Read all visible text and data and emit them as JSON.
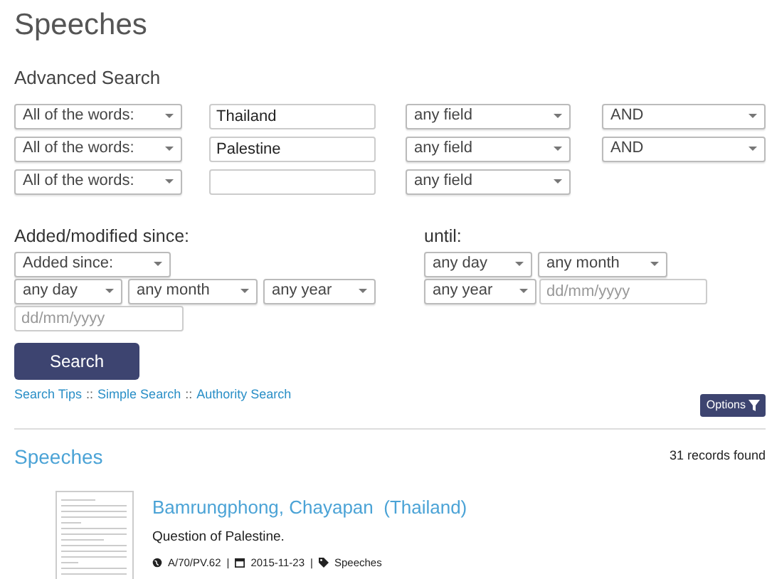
{
  "title": "Speeches",
  "advanced_search": {
    "heading": "Advanced Search",
    "rows": [
      {
        "match": "All of the words:",
        "term": "Thailand",
        "field": "any field",
        "operator": "AND"
      },
      {
        "match": "All of the words:",
        "term": "Palestine",
        "field": "any field",
        "operator": "AND"
      },
      {
        "match": "All of the words:",
        "term": "",
        "field": "any field"
      }
    ]
  },
  "since": {
    "heading": "Added/modified since:",
    "mode": "Added since:",
    "day": "any day",
    "month": "any month",
    "year": "any year",
    "date_placeholder": "dd/mm/yyyy"
  },
  "until": {
    "heading": "until:",
    "day": "any day",
    "month": "any month",
    "year": "any year",
    "date_placeholder": "dd/mm/yyyy"
  },
  "search_button": "Search",
  "links": [
    "Search Tips",
    "Simple Search",
    "Authority Search"
  ],
  "link_separator": "::",
  "meta_separator": "|",
  "options_button": "Options",
  "results": {
    "heading": "Speeches",
    "count": "31 records found",
    "items": [
      {
        "title": "Bamrungphong, Chayapan  (Thailand)",
        "summary": "Question of Palestine.",
        "symbol": "A/70/PV.62",
        "date": "2015-11-23",
        "type": "Speeches"
      }
    ]
  }
}
